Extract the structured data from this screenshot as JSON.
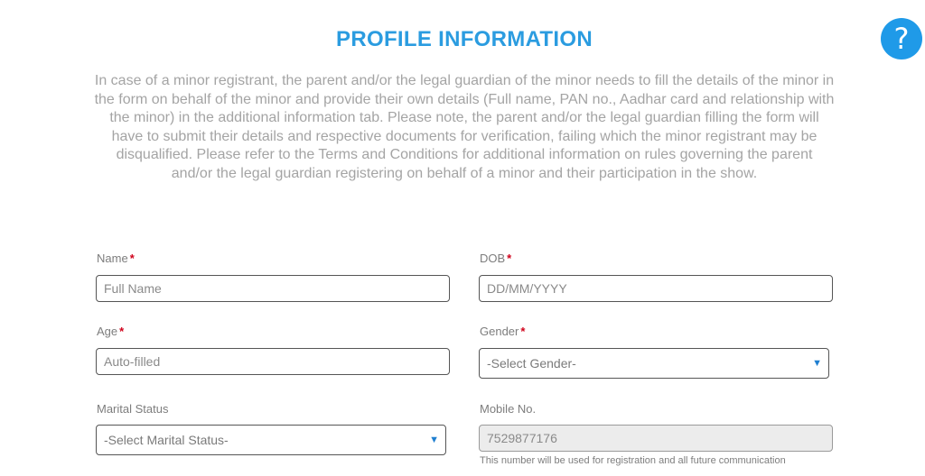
{
  "help": {
    "glyph": "?"
  },
  "header": {
    "title": "PROFILE INFORMATION",
    "intro": "In case of a minor registrant, the parent and/or the legal guardian of the minor needs to fill the details of the minor in the form on behalf of the minor and provide their own details (Full name, PAN no., Aadhar card and relationship with the minor) in the additional information tab. Please note, the parent and/or the legal guardian filling the form will have to submit their details and respective documents for verification, failing which the minor registrant may be disqualified. Please refer to the Terms and Conditions for additional information on rules governing the parent and/or the legal guardian registering on behalf of a minor and their participation in the show."
  },
  "form": {
    "required_mark": "*",
    "name": {
      "label": "Name",
      "placeholder": "Full Name",
      "value": ""
    },
    "dob": {
      "label": "DOB",
      "placeholder": "DD/MM/YYYY",
      "value": ""
    },
    "age": {
      "label": "Age",
      "placeholder": "Auto-filled",
      "value": ""
    },
    "gender": {
      "label": "Gender",
      "selected": "-Select Gender-"
    },
    "marital_status": {
      "label": "Marital Status",
      "selected": "-Select Marital Status-"
    },
    "mobile": {
      "label": "Mobile No.",
      "value": "7529877176",
      "hint": "This number will be used for registration and all future communication"
    }
  },
  "colors": {
    "accent": "#2b9ce0",
    "required": "#d0021b",
    "help_button": "#1f9ae8"
  }
}
